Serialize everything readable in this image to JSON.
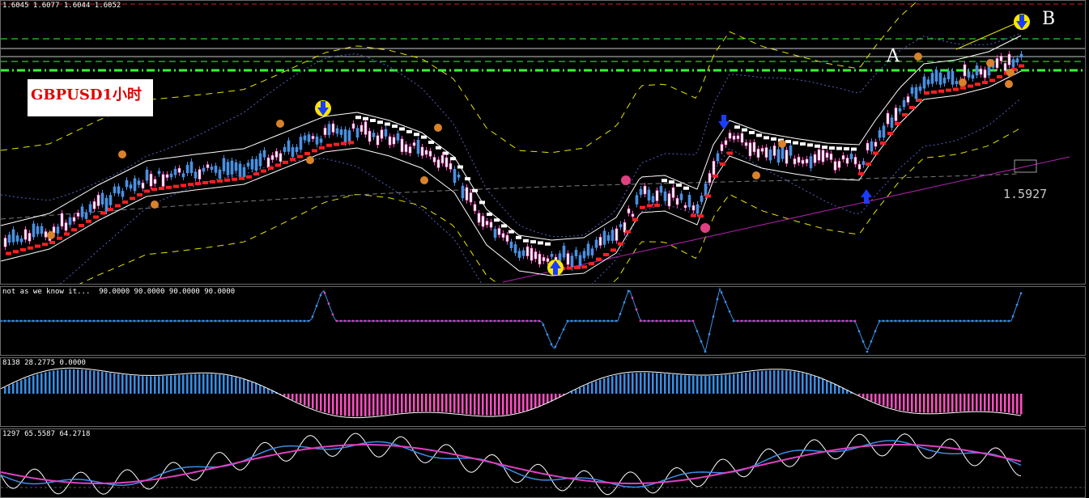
{
  "main_pane": {
    "ohlc_readout": "1.6045 1.6077 1.6044 1.6052",
    "symbol_label": "GBPUSD1小时",
    "marker_a": "A",
    "marker_b": "B",
    "price_label": "1.5927"
  },
  "indicator_1": {
    "readout": "not as we know it...  90.0000 90.0000 90.0000 90.0000"
  },
  "indicator_2": {
    "readout": "8138 28.2775 0.0000"
  },
  "indicator_3": {
    "readout": "1297 65.5587 64.2718"
  },
  "colors": {
    "background": "#000000",
    "bull_candle": "#4a90e2",
    "bear_candle": "#ff4fc0",
    "ma_red": "#ff2020",
    "band_white": "#ffffff",
    "envelope_yellow": "#e6e600",
    "level_green": "#33ff33",
    "indicator_blue": "#3a8ee6",
    "indicator_magenta": "#e040c0",
    "trend_magenta": "#b020b0"
  },
  "icons": [
    "sell-arrow-icon",
    "buy-arrow-icon",
    "fractal-marker-icon"
  ]
}
